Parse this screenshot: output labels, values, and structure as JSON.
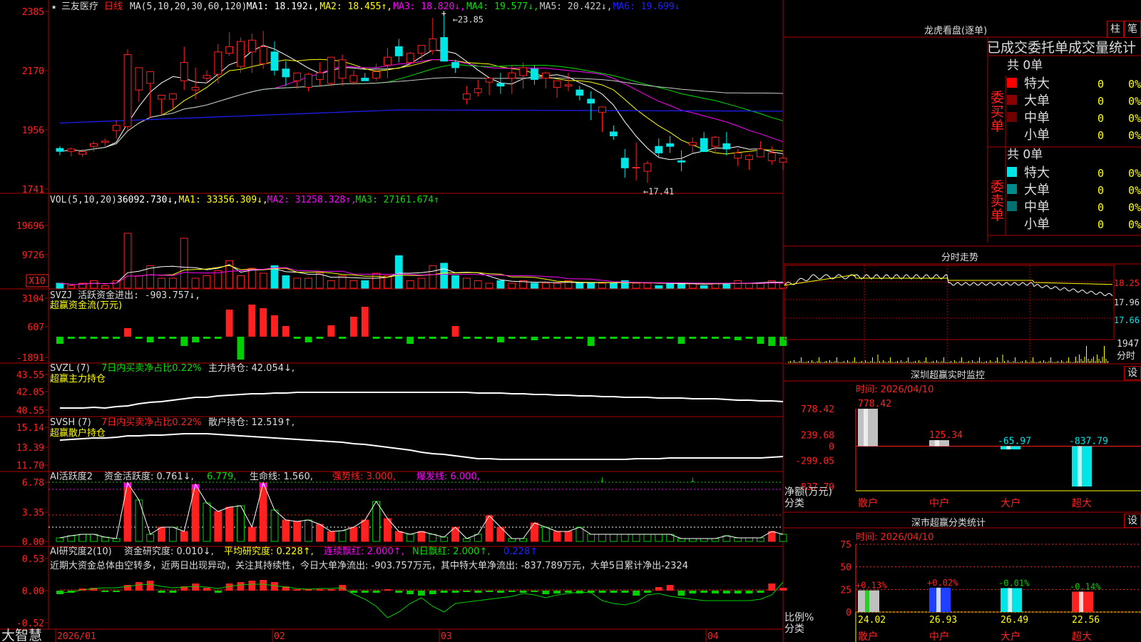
{
  "stock": {
    "name": "三友医疗",
    "period": "日线",
    "star": "★"
  },
  "brand": "大智慧",
  "colors": {
    "up": "#ff2020",
    "down": "#00e5e5",
    "ma1": "#ffffff",
    "ma2": "#ffff00",
    "ma3": "#ff00ff",
    "ma4": "#00e000",
    "ma5": "#c8c8c8",
    "ma6": "#2020ff",
    "border": "#b00000",
    "green": "#00d000",
    "magenta": "#ff00ff",
    "yellow": "#ffff00"
  },
  "panels": {
    "price": {
      "header": [
        {
          "t": "MA(5,10,20,30,60,120)",
          "c": "#dddddd"
        },
        {
          "t": "MA1: 18.192↓,",
          "c": "#ffffff"
        },
        {
          "t": "MA2: 18.455↑,",
          "c": "#ffff00"
        },
        {
          "t": "MA3: 18.820↓,",
          "c": "#ff00ff"
        },
        {
          "t": "MA4: 19.577↓,",
          "c": "#00e000"
        },
        {
          "t": "MA5: 20.422↓,",
          "c": "#c8c8c8"
        },
        {
          "t": "MA6: 19.699↓",
          "c": "#2020ff"
        }
      ],
      "yticks": [
        "2385",
        "2170",
        "1956",
        "1741"
      ],
      "high_label": "23.85",
      "low_label": "17.41"
    },
    "vol": {
      "header": [
        {
          "t": "VOL(5,10,20)",
          "c": "#dddddd"
        },
        {
          "t": "36092.730↓,",
          "c": "#ffffff"
        },
        {
          "t": "MA1: 33356.309↓,",
          "c": "#ffff00"
        },
        {
          "t": "MA2: 31258.328↑,",
          "c": "#ff00ff"
        },
        {
          "t": "MA3: 27161.674↑",
          "c": "#00e000"
        }
      ],
      "yticks": [
        "19696",
        "9726"
      ],
      "unit": "X10"
    },
    "svzj": {
      "header": [
        {
          "t": "SVZJ  活跃资金进出: -903.757↓,",
          "c": "#dddddd"
        }
      ],
      "sub": "超赢资金流(万元)",
      "yticks": [
        "3104",
        "607",
        "-1891"
      ]
    },
    "svzl": {
      "header": [
        {
          "t": "SVZL (7)",
          "c": "#dddddd"
        },
        {
          "t": "7日内买卖净占比0.22%",
          "c": "#00e000"
        },
        {
          "t": "主力持仓: 42.054↓,",
          "c": "#dddddd"
        }
      ],
      "sub": "超赢主力持仓",
      "yticks": [
        "43.55",
        "42.05",
        "40.55"
      ]
    },
    "svsh": {
      "header": [
        {
          "t": "SVSH (7)",
          "c": "#dddddd"
        },
        {
          "t": "7日内买卖净占比0.22%",
          "c": "#ff2020"
        },
        {
          "t": "散户持仓: 12.519↑,",
          "c": "#dddddd"
        }
      ],
      "sub": "超赢散户持仓",
      "yticks": [
        "15.14",
        "13.39",
        "11.70"
      ]
    },
    "ai": {
      "header": [
        {
          "t": "AI活跃度2",
          "c": "#dddddd"
        },
        {
          "t": "资金活跃度: 0.761↓,",
          "c": "#dddddd"
        },
        {
          "t": "6.779,",
          "c": "#00e000"
        },
        {
          "t": "生命线: 1.560,",
          "c": "#dddddd"
        },
        {
          "t": "强势线: 3.000,",
          "c": "#ff2020"
        },
        {
          "t": "爆发线: 6.000,",
          "c": "#ff00ff"
        }
      ],
      "yticks": [
        "6.78",
        "3.35",
        "0.00"
      ]
    },
    "airs": {
      "header": [
        {
          "t": "AI研究度2(10)",
          "c": "#dddddd"
        },
        {
          "t": "资金研究度: 0.010↓,",
          "c": "#dddddd"
        },
        {
          "t": "平均研究度: 0.228↑,",
          "c": "#ffff00"
        },
        {
          "t": "连续飘红: 2.000↑,",
          "c": "#ff00ff"
        },
        {
          "t": "N日飘红: 2.000↑,",
          "c": "#00e000"
        },
        {
          "t": "0.228↑",
          "c": "#2020ff"
        }
      ],
      "note": "近期大资金总体由空转多，近两日出现异动，关注其持续性，今日大单净流出: -903.757万元，其中特大单净流出: -837.789万元，大单5日累计净出-2324",
      "yticks": [
        "0.53",
        "0.00",
        "-0.52"
      ]
    }
  },
  "xaxis": [
    "2026/01",
    "02",
    "03",
    "04"
  ],
  "chart_data": {
    "type": "candlestick",
    "ohlc": [
      [
        18.72,
        18.81,
        18.46,
        18.61
      ],
      [
        18.61,
        18.75,
        18.42,
        18.7
      ],
      [
        18.5,
        18.7,
        18.4,
        18.6
      ],
      [
        18.8,
        19.0,
        18.6,
        18.9
      ],
      [
        18.95,
        19.1,
        18.8,
        19.0
      ],
      [
        19.4,
        19.8,
        19.1,
        19.6
      ],
      [
        19.55,
        22.5,
        19.4,
        22.3
      ],
      [
        20.95,
        21.65,
        20.5,
        21.8
      ],
      [
        21.2,
        21.45,
        19.9,
        21.65
      ],
      [
        20.6,
        20.7,
        20.0,
        20.75
      ],
      [
        20.6,
        20.65,
        20.25,
        20.8
      ],
      [
        21.3,
        22.6,
        20.95,
        22.0
      ],
      [
        20.95,
        21.8,
        20.6,
        21.05
      ],
      [
        21.4,
        21.7,
        21.2,
        21.5
      ],
      [
        21.55,
        22.7,
        21.2,
        22.4
      ],
      [
        22.35,
        23.15,
        22.25,
        22.6
      ],
      [
        21.85,
        22.95,
        21.6,
        22.8
      ],
      [
        22.4,
        23.1,
        21.6,
        22.85
      ],
      [
        21.95,
        23.2,
        21.75,
        22.6
      ],
      [
        22.4,
        22.8,
        21.5,
        21.7
      ],
      [
        21.75,
        22.05,
        21.1,
        21.45
      ],
      [
        21.3,
        21.6,
        21.0,
        21.6
      ],
      [
        21.05,
        21.6,
        20.9,
        21.55
      ],
      [
        21.35,
        22.0,
        21.1,
        21.6
      ],
      [
        21.2,
        22.05,
        21.1,
        22.2
      ],
      [
        21.4,
        22.3,
        21.1,
        22.1
      ],
      [
        21.25,
        21.7,
        21.15,
        21.5
      ],
      [
        21.4,
        21.6,
        21.3,
        21.3
      ],
      [
        21.4,
        21.95,
        21.3,
        21.65
      ],
      [
        21.9,
        22.55,
        21.4,
        22.2
      ],
      [
        22.6,
        22.9,
        22.0,
        22.25
      ],
      [
        22.0,
        22.4,
        21.9,
        22.35
      ],
      [
        22.35,
        22.45,
        22.1,
        22.65
      ],
      [
        22.45,
        23.7,
        22.3,
        22.9
      ],
      [
        22.95,
        23.85,
        22.2,
        22.05
      ],
      [
        22.0,
        22.1,
        21.6,
        21.8
      ],
      [
        20.6,
        21.1,
        20.4,
        20.8
      ],
      [
        20.85,
        21.35,
        20.7,
        21.0
      ],
      [
        21.25,
        21.4,
        20.75,
        21.4
      ],
      [
        21.2,
        21.6,
        20.8,
        21.1
      ],
      [
        21.4,
        21.9,
        20.8,
        21.6
      ],
      [
        21.5,
        22.0,
        21.0,
        21.8
      ],
      [
        21.75,
        21.9,
        21.15,
        21.35
      ],
      [
        21.4,
        21.65,
        21.0,
        21.6
      ],
      [
        21.05,
        21.2,
        20.65,
        21.3
      ],
      [
        21.1,
        21.6,
        20.9,
        21.15
      ],
      [
        20.95,
        21.1,
        20.55,
        20.75
      ],
      [
        20.6,
        20.9,
        19.8,
        20.45
      ],
      [
        20.1,
        20.25,
        19.35,
        20.3
      ],
      [
        19.35,
        19.6,
        19.05,
        19.2
      ],
      [
        18.35,
        18.7,
        17.6,
        17.98
      ],
      [
        18.0,
        18.95,
        17.5,
        18.0
      ],
      [
        17.85,
        18.25,
        17.41,
        18.15
      ],
      [
        18.8,
        19.1,
        18.4,
        18.55
      ],
      [
        18.9,
        19.2,
        18.55,
        18.8
      ],
      [
        18.25,
        18.65,
        17.85,
        18.2
      ],
      [
        18.85,
        19.15,
        18.55,
        18.95
      ],
      [
        19.1,
        19.35,
        18.95,
        18.6
      ],
      [
        18.8,
        19.2,
        18.6,
        19.15
      ],
      [
        18.9,
        19.35,
        18.45,
        18.7
      ],
      [
        18.35,
        18.7,
        18.05,
        18.55
      ],
      [
        18.3,
        18.5,
        17.9,
        18.45
      ],
      [
        18.4,
        19.0,
        18.4,
        18.7
      ],
      [
        18.25,
        18.8,
        18.1,
        18.55
      ],
      [
        18.2,
        18.55,
        17.9,
        18.35
      ]
    ]
  },
  "right": {
    "lhb": {
      "title": "龙虎看盘(逐单)",
      "btn1": "柱",
      "btn2": "笔",
      "tabs": "已成交委托单成交量统计",
      "buy_label": "委买单",
      "sell_label": "委卖单",
      "total": "共 0单",
      "rows": [
        "特大",
        "大单",
        "中单",
        "小单"
      ],
      "zero": "0",
      "pct": "0%",
      "buy_colors": [
        "#ff0000",
        "#8b0000",
        "#6e0000",
        "#000000"
      ],
      "sell_colors": [
        "#00e5e5",
        "#008b8b",
        "#007070",
        "#000000"
      ]
    },
    "fs": {
      "title": "分时走势",
      "prices": [
        "18.25",
        "17.96",
        "17.66"
      ],
      "vol_label": "1947",
      "unit_label": "分时"
    },
    "mon": {
      "title": "深圳超赢实时监控",
      "time": "时间: 2026/04/10",
      "set": "设",
      "yticks": [
        "778.42",
        "239.68",
        "0",
        "-299.05",
        "-837.79"
      ],
      "ylabel": "净额(万元)",
      "xlabel": "分类",
      "cats": [
        "散户",
        "中户",
        "大户",
        "超大"
      ],
      "values": [
        778.42,
        125.34,
        -65.97,
        -837.79
      ],
      "value_labels": [
        "778.42",
        "125.34",
        "-65.97",
        "-837.79"
      ]
    },
    "cls": {
      "title": "深市超赢分类统计",
      "time": "时间: 2026/04/10",
      "set": "设",
      "yticks": [
        "75",
        "50",
        "25",
        "0"
      ],
      "ylabel": "比例%",
      "xlabel": "分类",
      "cats": [
        "散户",
        "中户",
        "大户",
        "超大"
      ],
      "values": [
        24.02,
        26.93,
        26.49,
        22.56
      ],
      "value_labels": [
        "24.02",
        "26.93",
        "26.49",
        "22.56"
      ],
      "changes": [
        "+0.13%",
        "+0.02%",
        "-0.01%",
        "-0.14%"
      ]
    }
  }
}
